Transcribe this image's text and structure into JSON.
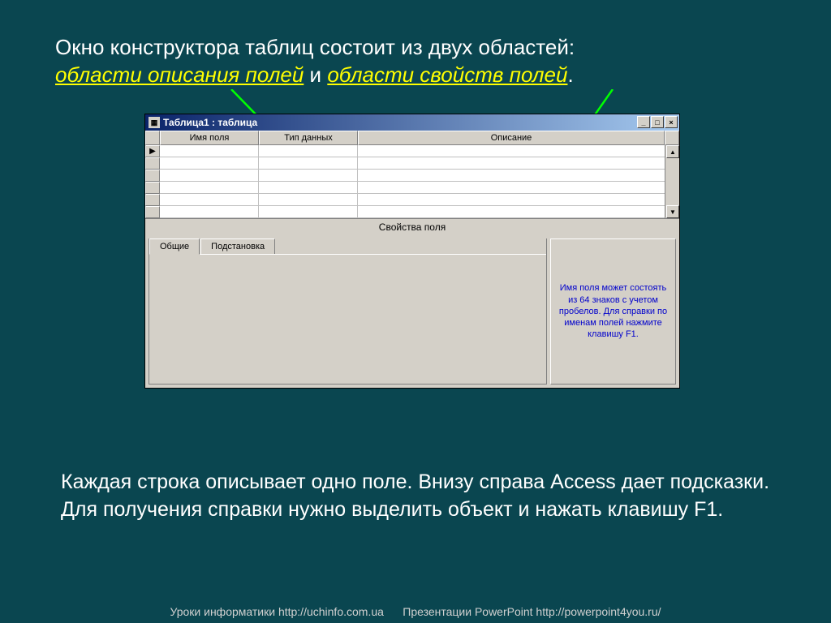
{
  "top_text": {
    "line1a": "Окно конструктора таблиц состоит из двух областей:",
    "region1": "области описания полей",
    "conj": " и ",
    "region2": "области свойств полей",
    "period": "."
  },
  "window": {
    "title": "Таблица1 : таблица",
    "columns": {
      "field_name": "Имя поля",
      "data_type": "Тип данных",
      "description": "Описание"
    },
    "props_title": "Свойства поля",
    "tabs": {
      "general": "Общие",
      "lookup": "Подстановка"
    },
    "help": "Имя поля может состоять из 64 знаков с учетом пробелов. Для справки по именам полей нажмите клавишу F1."
  },
  "bottom_text": "Каждая строка описывает одно поле. Внизу справа Access дает подсказки. Для получения справки нужно выделить объект и нажать клавишу F1.",
  "footer": {
    "left": "Уроки информатики  http://uchinfo.com.ua",
    "right": "Презентации PowerPoint  http://powerpoint4you.ru/"
  }
}
